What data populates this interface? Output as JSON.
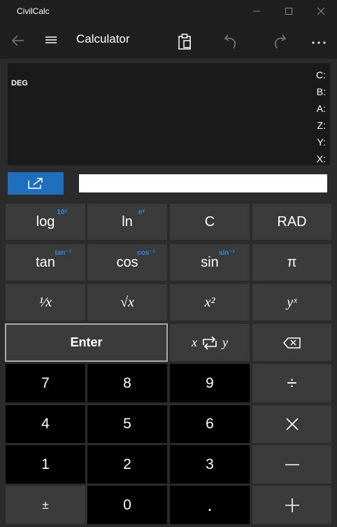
{
  "window": {
    "title": "CivilCalc"
  },
  "appbar": {
    "title": "Calculator"
  },
  "display": {
    "mode": "DEG",
    "stack": [
      "C:",
      "B:",
      "A:",
      "Z:",
      "Y:",
      "X:"
    ]
  },
  "entry": {
    "value": ""
  },
  "keys": {
    "log": {
      "label": "log",
      "secondary": "10ˣ"
    },
    "ln": {
      "label": "ln",
      "secondary": "eˣ"
    },
    "clear": {
      "label": "C"
    },
    "rad": {
      "label": "RAD"
    },
    "tan": {
      "label": "tan",
      "secondary": "tan⁻¹"
    },
    "cos": {
      "label": "cos",
      "secondary": "cos⁻¹"
    },
    "sin": {
      "label": "sin",
      "secondary": "sin⁻¹"
    },
    "pi": {
      "label": "π"
    },
    "reciprocal": {
      "label": "¹⁄x"
    },
    "sqrt": {
      "label": "√x"
    },
    "square": {
      "label": "x²"
    },
    "power": {
      "label": "yˣ"
    },
    "enter": {
      "label": "Enter"
    },
    "swap": {
      "left": "x",
      "right": "y"
    },
    "n7": {
      "label": "7"
    },
    "n8": {
      "label": "8"
    },
    "n9": {
      "label": "9"
    },
    "divide": {
      "label": "÷"
    },
    "n4": {
      "label": "4"
    },
    "n5": {
      "label": "5"
    },
    "n6": {
      "label": "6"
    },
    "n1": {
      "label": "1"
    },
    "n2": {
      "label": "2"
    },
    "n3": {
      "label": "3"
    },
    "plusminus": {
      "label": "±"
    },
    "n0": {
      "label": "0"
    },
    "decimal": {
      "label": "."
    }
  },
  "colors": {
    "accent": "#1f6fbf",
    "secondary_label": "#2a8ce6"
  },
  "icons": [
    "back-arrow-icon",
    "hamburger-menu-icon",
    "clipboard-icon",
    "undo-icon",
    "redo-icon",
    "more-icon",
    "popout-icon",
    "swap-icon",
    "backspace-icon",
    "multiply-icon",
    "minus-icon",
    "plus-icon"
  ]
}
